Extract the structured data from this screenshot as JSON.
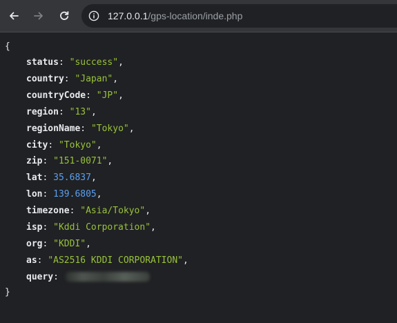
{
  "browser": {
    "url_host": "127.0.0.1",
    "url_path": "/gps-location/inde.php"
  },
  "json_view": {
    "open_brace": "{",
    "close_brace": "}",
    "entries": [
      {
        "key": "status",
        "value": "\"success\"",
        "type": "string"
      },
      {
        "key": "country",
        "value": "\"Japan\"",
        "type": "string"
      },
      {
        "key": "countryCode",
        "value": "\"JP\"",
        "type": "string"
      },
      {
        "key": "region",
        "value": "\"13\"",
        "type": "string"
      },
      {
        "key": "regionName",
        "value": "\"Tokyo\"",
        "type": "string"
      },
      {
        "key": "city",
        "value": "\"Tokyo\"",
        "type": "string"
      },
      {
        "key": "zip",
        "value": "\"151-0071\"",
        "type": "string"
      },
      {
        "key": "lat",
        "value": "35.6837",
        "type": "number"
      },
      {
        "key": "lon",
        "value": "139.6805",
        "type": "number"
      },
      {
        "key": "timezone",
        "value": "\"Asia/Tokyo\"",
        "type": "string"
      },
      {
        "key": "isp",
        "value": "\"Kddi Corporation\"",
        "type": "string"
      },
      {
        "key": "org",
        "value": "\"KDDI\"",
        "type": "string"
      },
      {
        "key": "as",
        "value": "\"AS2516 KDDI CORPORATION\"",
        "type": "string"
      },
      {
        "key": "query",
        "value": "",
        "type": "redacted"
      }
    ]
  },
  "colors": {
    "toolbar": "#35363a",
    "page_background": "#202124",
    "string_value": "#98c33a",
    "number_value": "#5aa0f0"
  }
}
